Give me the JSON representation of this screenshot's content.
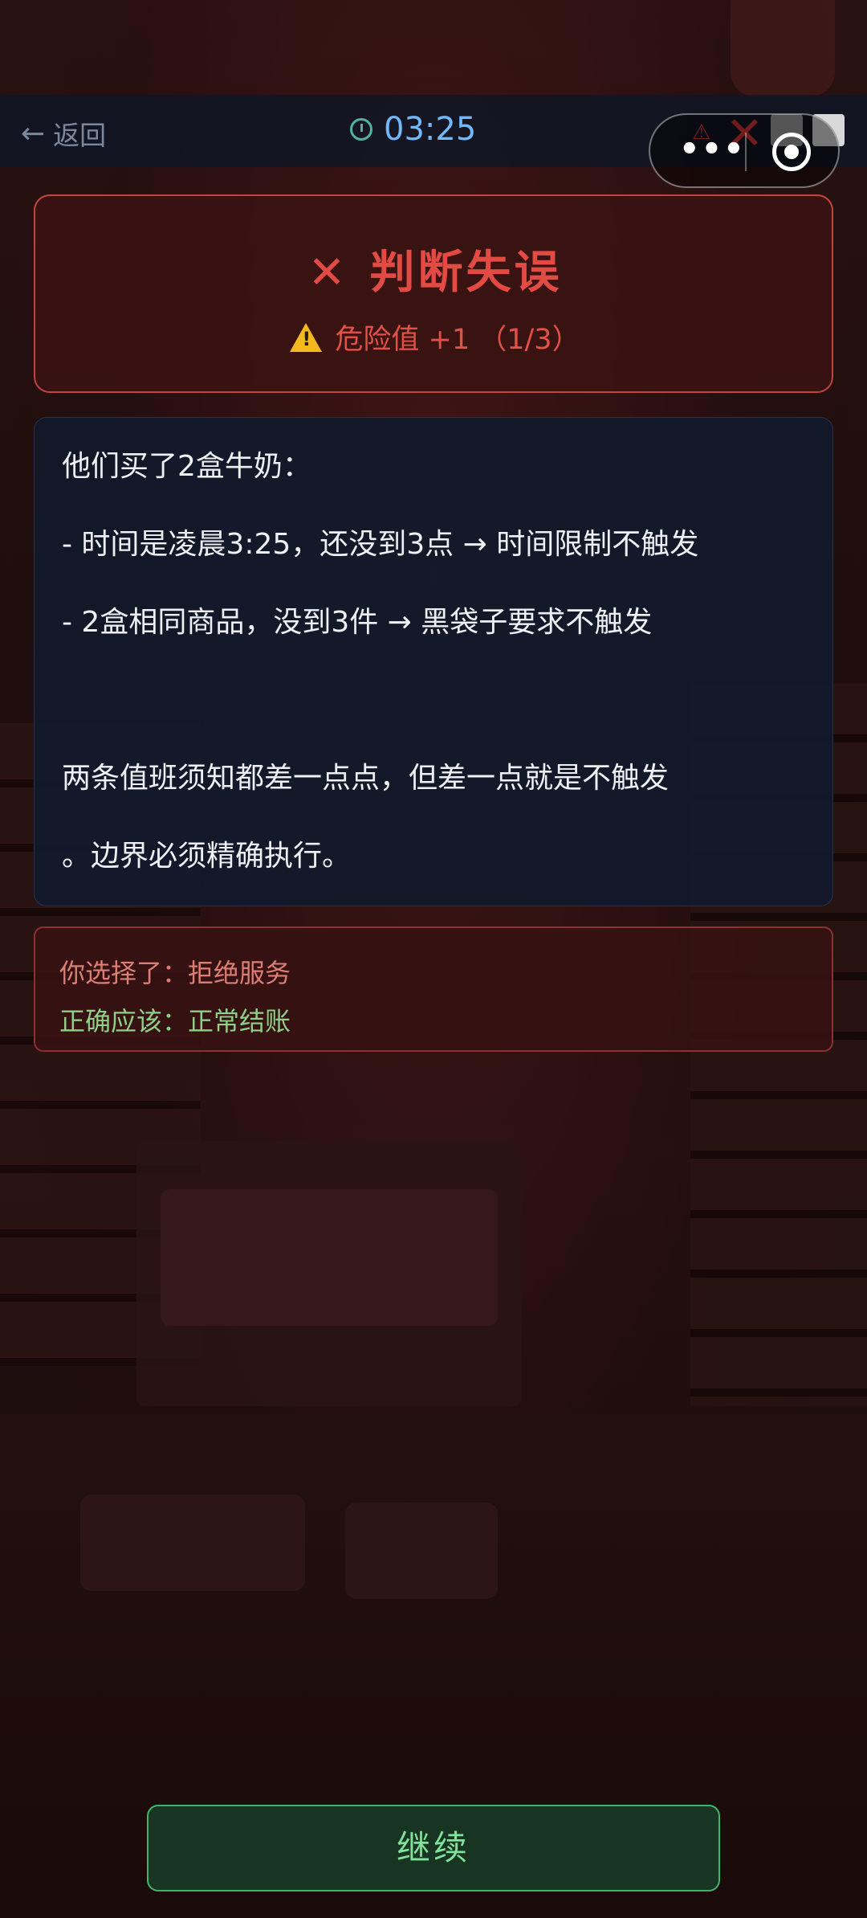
{
  "nav": {
    "back_label": "返回",
    "timer": "03:25"
  },
  "result": {
    "title": "判断失误",
    "danger_text": "危险值 +1 （1/3）"
  },
  "explanation": {
    "lines": [
      "他们买了2盒牛奶：",
      "- 时间是凌晨3:25，还没到3点 → 时间限制不触发",
      "- 2盒相同商品，没到3件 → 黑袋子要求不触发",
      "",
      "两条值班须知都差一点点，但差一点就是不触发",
      "。边界必须精确执行。"
    ]
  },
  "choice": {
    "chosen": "你选择了：拒绝服务",
    "correct": "正确应该：正常结账"
  },
  "continue_label": "继续",
  "colors": {
    "error_red": "#e24a44",
    "correct_green": "#8fcf86",
    "timer_blue": "#6fb9ff",
    "button_green": "#3fb569"
  }
}
